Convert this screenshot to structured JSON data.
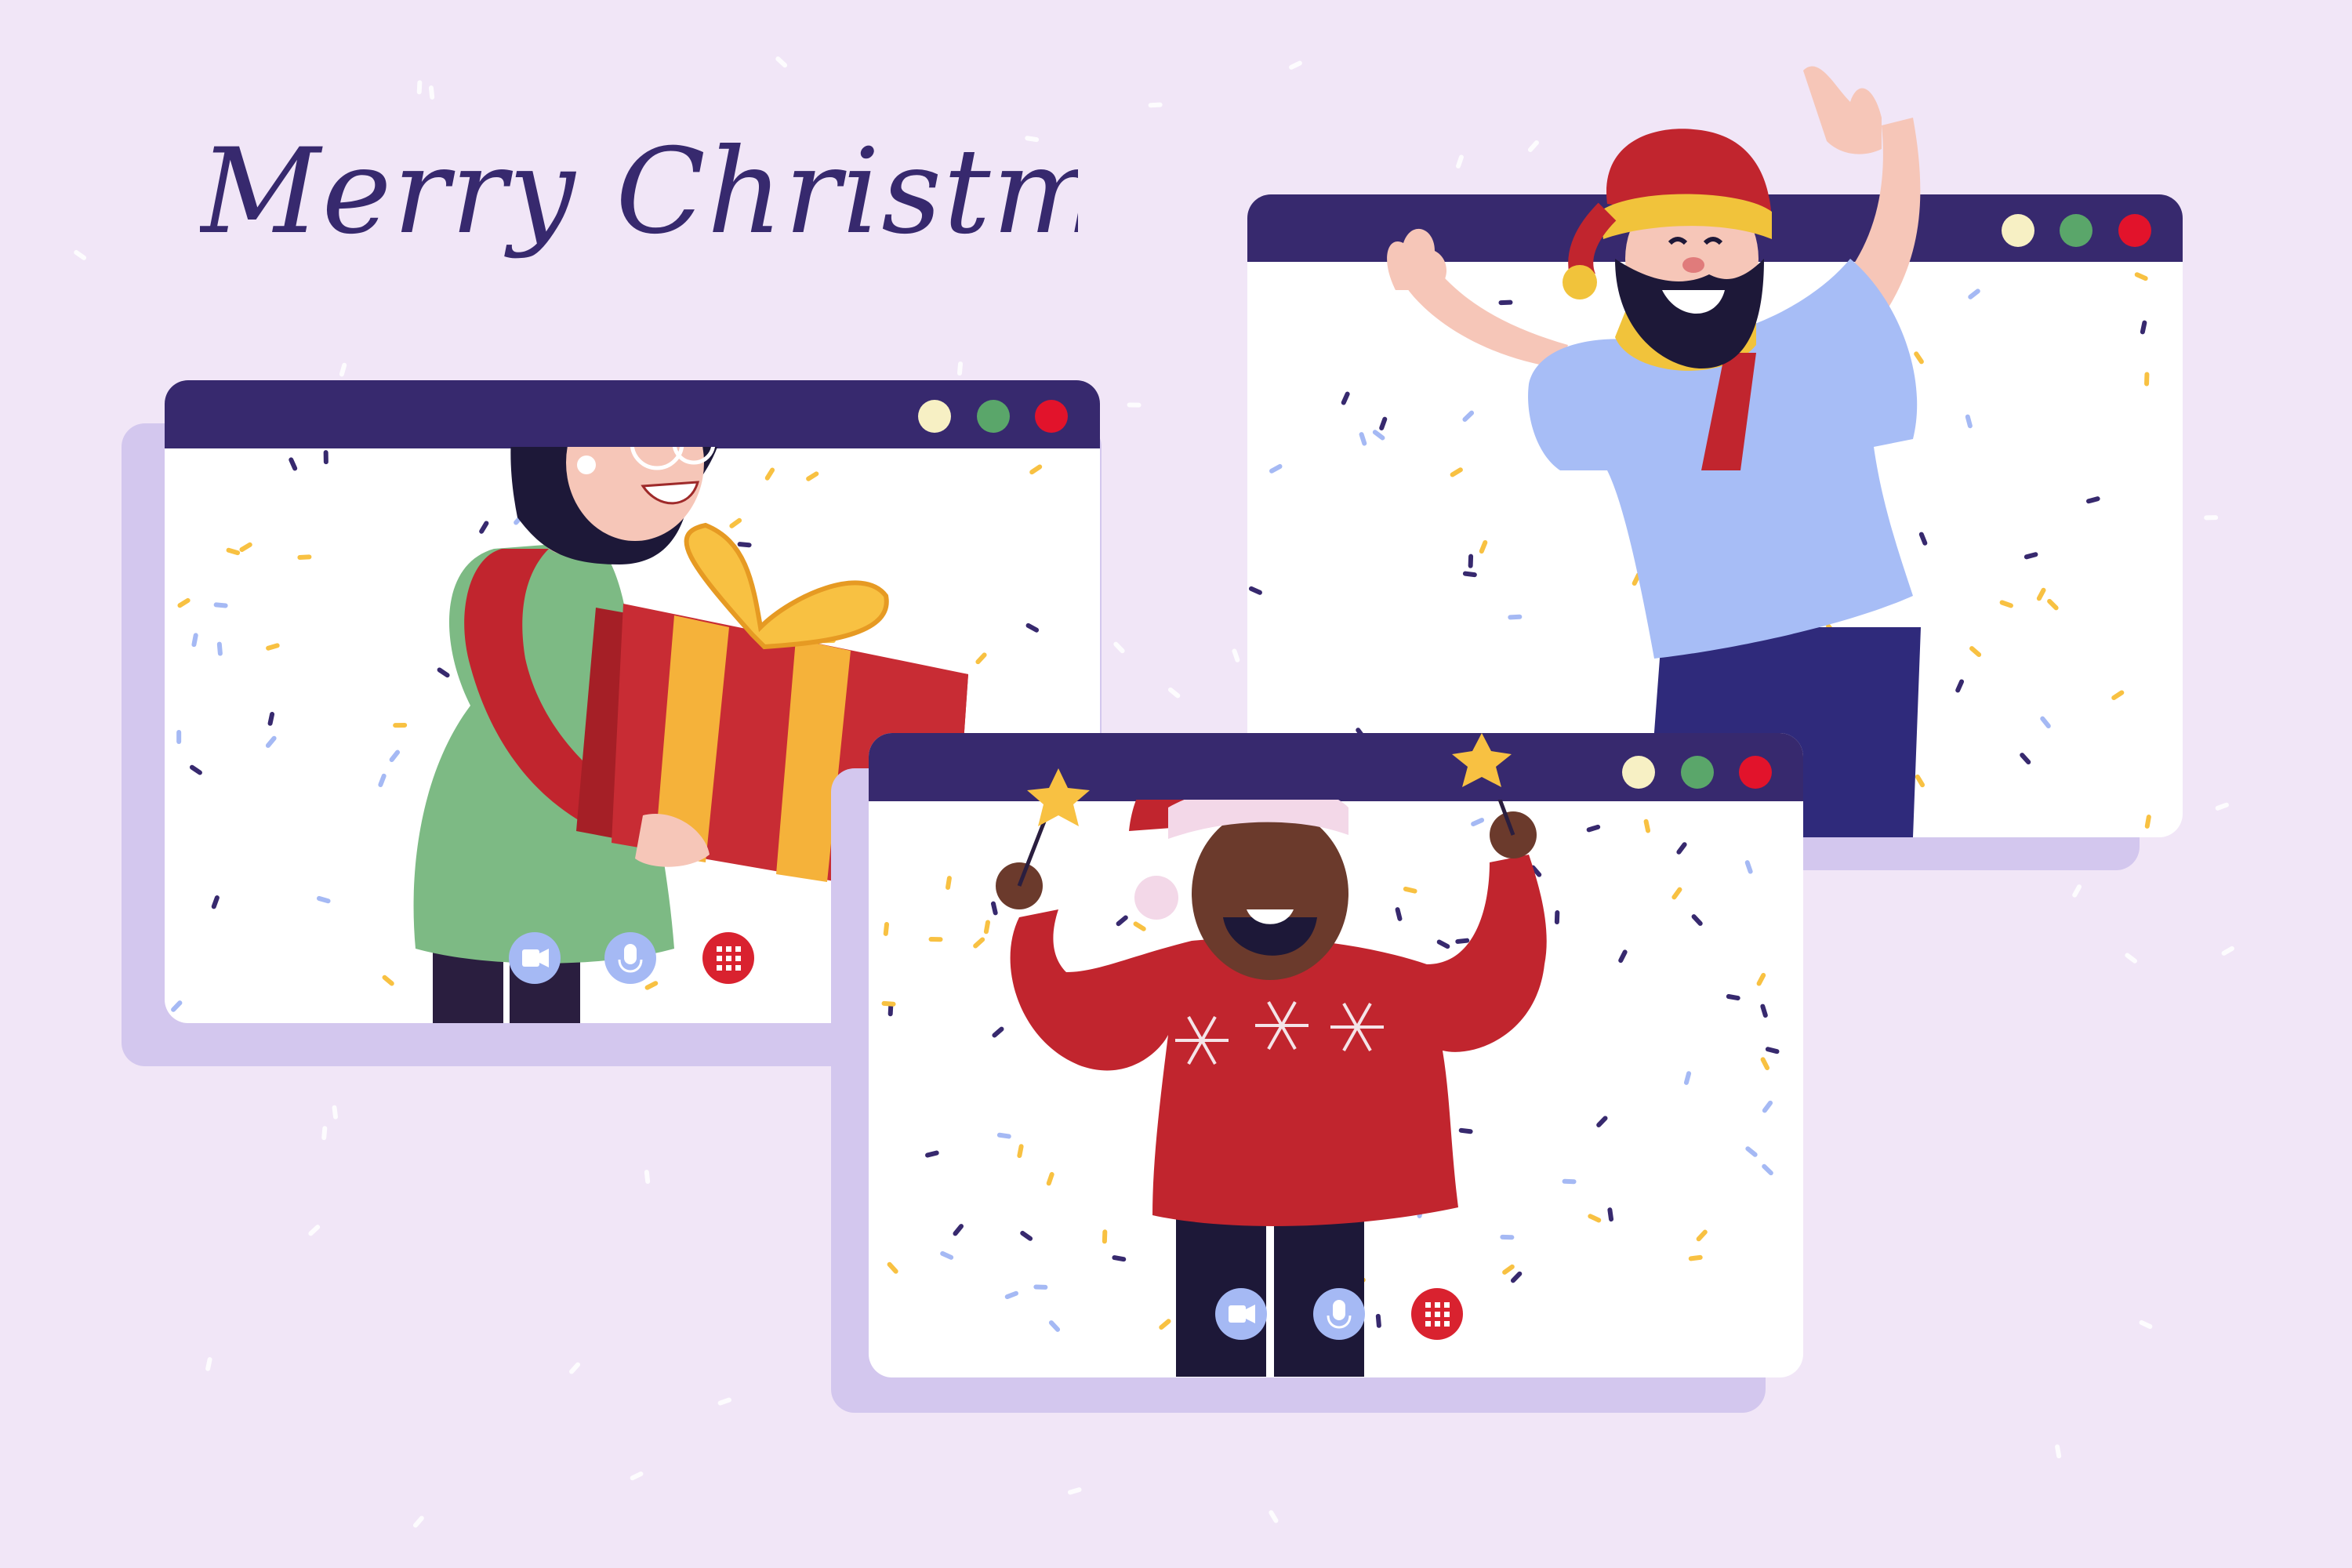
{
  "greeting": {
    "text": "Merry Christmas"
  },
  "colors": {
    "background": "#f1e6f7",
    "titlebar": "#37296e",
    "window_shadow": "#d3c7ee",
    "dot_yellow": "#f7f0c4",
    "dot_green": "#5aa66a",
    "dot_red": "#e2132b",
    "control_blue": "#a5b9f4",
    "control_red": "#d9222f",
    "title_text": "#37296e"
  },
  "call_windows": [
    {
      "name": "left-call-window",
      "participant": "woman-with-gift",
      "controls": [
        "camera-icon",
        "microphone-icon",
        "dialpad-icon"
      ]
    },
    {
      "name": "right-call-window",
      "participant": "bearded-man-waving",
      "controls": [
        "dialpad-icon"
      ]
    },
    {
      "name": "center-call-window",
      "participant": "man-with-sparklers",
      "controls": [
        "camera-icon",
        "microphone-icon",
        "dialpad-icon"
      ]
    }
  ]
}
